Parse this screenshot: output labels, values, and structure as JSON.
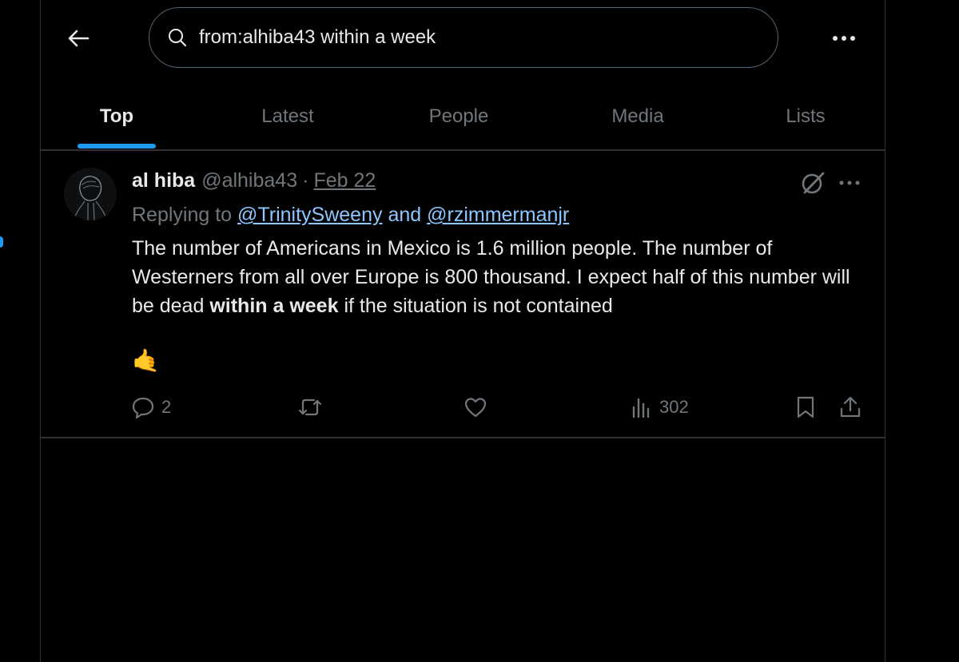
{
  "search": {
    "query": "from:alhiba43 within a week"
  },
  "tabs": [
    {
      "label": "Top",
      "active": true
    },
    {
      "label": "Latest",
      "active": false
    },
    {
      "label": "People",
      "active": false
    },
    {
      "label": "Media",
      "active": false
    },
    {
      "label": "Lists",
      "active": false
    }
  ],
  "tweet": {
    "author_name": "al hiba",
    "handle": "@alhiba43",
    "separator": "·",
    "date": "Feb 22",
    "reply_prefix": "Replying to",
    "reply_to": [
      "@TrinitySweeny",
      "@rzimmermanjr"
    ],
    "reply_joiner": "and",
    "text_before": "The number of Americans in Mexico is 1.6 million people. The number of Westerners from all over Europe is 800 thousand. I expect half of this number will be dead ",
    "text_bold": "within a week",
    "text_after": " if the situation is not contained",
    "emoji": "🤙",
    "stats": {
      "replies": "2",
      "views": "302"
    }
  },
  "colors": {
    "background": "#000000",
    "text_primary": "#e7e9ea",
    "text_secondary": "#71767b",
    "accent": "#1d9bf0",
    "link": "#8ec6ff",
    "border": "#2f3336"
  },
  "icons": {
    "back": "arrow-left-icon",
    "search": "search-icon",
    "more": "more-horizontal-icon",
    "grok": "grok-icon",
    "reply": "reply-icon",
    "retweet": "retweet-icon",
    "like": "heart-icon",
    "views": "views-chart-icon",
    "bookmark": "bookmark-icon",
    "share": "share-icon"
  }
}
